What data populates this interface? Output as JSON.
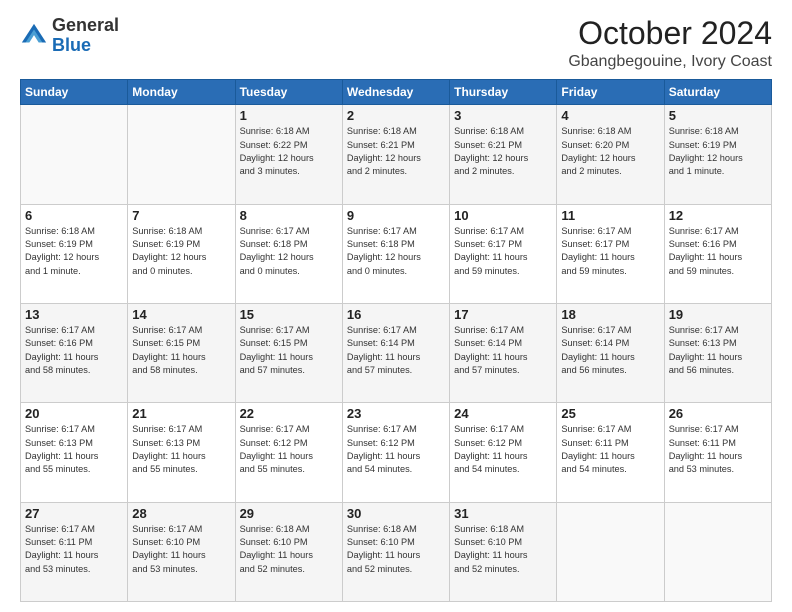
{
  "header": {
    "logo_general": "General",
    "logo_blue": "Blue",
    "month": "October 2024",
    "location": "Gbangbegouine, Ivory Coast"
  },
  "days_of_week": [
    "Sunday",
    "Monday",
    "Tuesday",
    "Wednesday",
    "Thursday",
    "Friday",
    "Saturday"
  ],
  "weeks": [
    [
      {
        "day": "",
        "info": ""
      },
      {
        "day": "",
        "info": ""
      },
      {
        "day": "1",
        "info": "Sunrise: 6:18 AM\nSunset: 6:22 PM\nDaylight: 12 hours\nand 3 minutes."
      },
      {
        "day": "2",
        "info": "Sunrise: 6:18 AM\nSunset: 6:21 PM\nDaylight: 12 hours\nand 2 minutes."
      },
      {
        "day": "3",
        "info": "Sunrise: 6:18 AM\nSunset: 6:21 PM\nDaylight: 12 hours\nand 2 minutes."
      },
      {
        "day": "4",
        "info": "Sunrise: 6:18 AM\nSunset: 6:20 PM\nDaylight: 12 hours\nand 2 minutes."
      },
      {
        "day": "5",
        "info": "Sunrise: 6:18 AM\nSunset: 6:19 PM\nDaylight: 12 hours\nand 1 minute."
      }
    ],
    [
      {
        "day": "6",
        "info": "Sunrise: 6:18 AM\nSunset: 6:19 PM\nDaylight: 12 hours\nand 1 minute."
      },
      {
        "day": "7",
        "info": "Sunrise: 6:18 AM\nSunset: 6:19 PM\nDaylight: 12 hours\nand 0 minutes."
      },
      {
        "day": "8",
        "info": "Sunrise: 6:17 AM\nSunset: 6:18 PM\nDaylight: 12 hours\nand 0 minutes."
      },
      {
        "day": "9",
        "info": "Sunrise: 6:17 AM\nSunset: 6:18 PM\nDaylight: 12 hours\nand 0 minutes."
      },
      {
        "day": "10",
        "info": "Sunrise: 6:17 AM\nSunset: 6:17 PM\nDaylight: 11 hours\nand 59 minutes."
      },
      {
        "day": "11",
        "info": "Sunrise: 6:17 AM\nSunset: 6:17 PM\nDaylight: 11 hours\nand 59 minutes."
      },
      {
        "day": "12",
        "info": "Sunrise: 6:17 AM\nSunset: 6:16 PM\nDaylight: 11 hours\nand 59 minutes."
      }
    ],
    [
      {
        "day": "13",
        "info": "Sunrise: 6:17 AM\nSunset: 6:16 PM\nDaylight: 11 hours\nand 58 minutes."
      },
      {
        "day": "14",
        "info": "Sunrise: 6:17 AM\nSunset: 6:15 PM\nDaylight: 11 hours\nand 58 minutes."
      },
      {
        "day": "15",
        "info": "Sunrise: 6:17 AM\nSunset: 6:15 PM\nDaylight: 11 hours\nand 57 minutes."
      },
      {
        "day": "16",
        "info": "Sunrise: 6:17 AM\nSunset: 6:14 PM\nDaylight: 11 hours\nand 57 minutes."
      },
      {
        "day": "17",
        "info": "Sunrise: 6:17 AM\nSunset: 6:14 PM\nDaylight: 11 hours\nand 57 minutes."
      },
      {
        "day": "18",
        "info": "Sunrise: 6:17 AM\nSunset: 6:14 PM\nDaylight: 11 hours\nand 56 minutes."
      },
      {
        "day": "19",
        "info": "Sunrise: 6:17 AM\nSunset: 6:13 PM\nDaylight: 11 hours\nand 56 minutes."
      }
    ],
    [
      {
        "day": "20",
        "info": "Sunrise: 6:17 AM\nSunset: 6:13 PM\nDaylight: 11 hours\nand 55 minutes."
      },
      {
        "day": "21",
        "info": "Sunrise: 6:17 AM\nSunset: 6:13 PM\nDaylight: 11 hours\nand 55 minutes."
      },
      {
        "day": "22",
        "info": "Sunrise: 6:17 AM\nSunset: 6:12 PM\nDaylight: 11 hours\nand 55 minutes."
      },
      {
        "day": "23",
        "info": "Sunrise: 6:17 AM\nSunset: 6:12 PM\nDaylight: 11 hours\nand 54 minutes."
      },
      {
        "day": "24",
        "info": "Sunrise: 6:17 AM\nSunset: 6:12 PM\nDaylight: 11 hours\nand 54 minutes."
      },
      {
        "day": "25",
        "info": "Sunrise: 6:17 AM\nSunset: 6:11 PM\nDaylight: 11 hours\nand 54 minutes."
      },
      {
        "day": "26",
        "info": "Sunrise: 6:17 AM\nSunset: 6:11 PM\nDaylight: 11 hours\nand 53 minutes."
      }
    ],
    [
      {
        "day": "27",
        "info": "Sunrise: 6:17 AM\nSunset: 6:11 PM\nDaylight: 11 hours\nand 53 minutes."
      },
      {
        "day": "28",
        "info": "Sunrise: 6:17 AM\nSunset: 6:10 PM\nDaylight: 11 hours\nand 53 minutes."
      },
      {
        "day": "29",
        "info": "Sunrise: 6:18 AM\nSunset: 6:10 PM\nDaylight: 11 hours\nand 52 minutes."
      },
      {
        "day": "30",
        "info": "Sunrise: 6:18 AM\nSunset: 6:10 PM\nDaylight: 11 hours\nand 52 minutes."
      },
      {
        "day": "31",
        "info": "Sunrise: 6:18 AM\nSunset: 6:10 PM\nDaylight: 11 hours\nand 52 minutes."
      },
      {
        "day": "",
        "info": ""
      },
      {
        "day": "",
        "info": ""
      }
    ]
  ]
}
